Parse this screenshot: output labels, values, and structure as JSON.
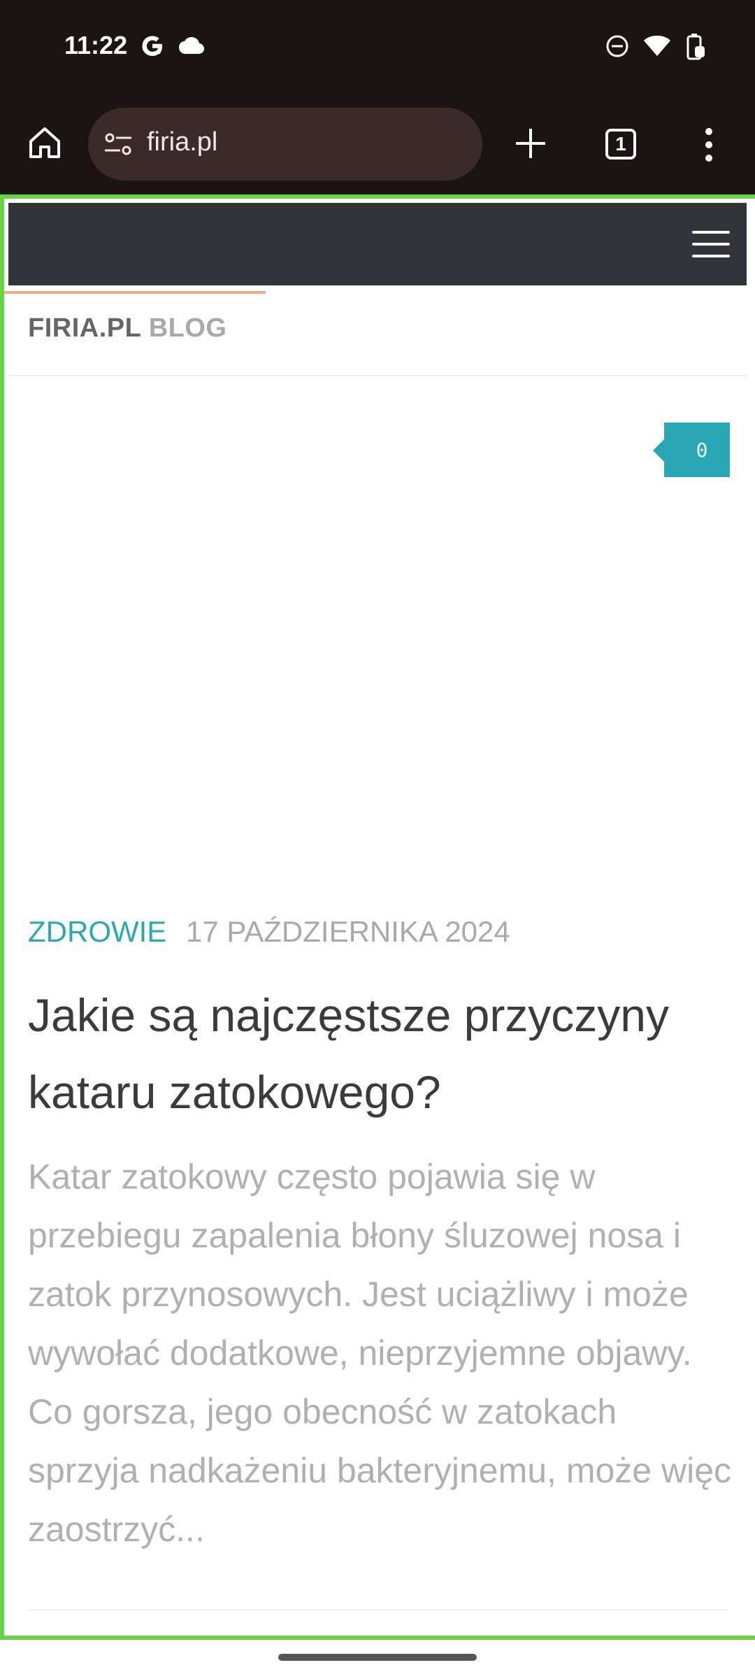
{
  "status": {
    "time": "11:22",
    "icons": [
      "google-icon",
      "cloud-icon",
      "dnd-icon",
      "wifi-icon",
      "battery-icon"
    ]
  },
  "browser": {
    "url": "firia.pl",
    "tab_count": "1"
  },
  "site": {
    "brand_main": "FIRIA.PL",
    "brand_sub": "BLOG",
    "comment_icon": "",
    "comment_count": "0"
  },
  "post": {
    "category": "ZDROWIE",
    "date": "17 PAŹDZIERNIKA 2024",
    "title": "Jakie są najczęstsze przyczyny kataru zatokowego?",
    "excerpt": "Katar zatokowy często pojawia się w przebiegu zapalenia błony śluzowej nosa i zatok przynosowych. Jest uciążliwy i może wywołać dodatkowe, nieprzyjemne objawy. Co gorsza, jego obecność w zatokach sprzyja nadkażeniu bakteryjnemu, może więc zaostrzyć..."
  },
  "colors": {
    "accent": "#2aa9b1",
    "frame": "#6ad246",
    "header": "#323439"
  }
}
